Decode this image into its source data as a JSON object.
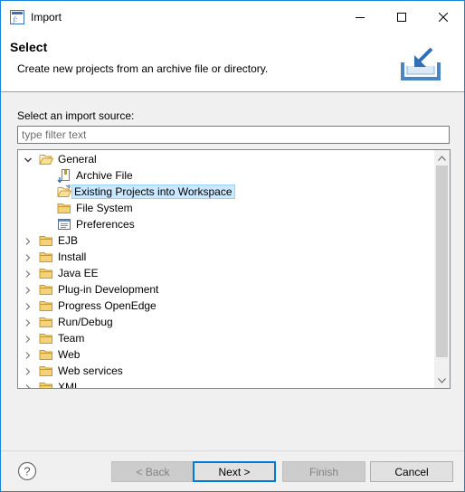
{
  "window": {
    "title": "Import"
  },
  "banner": {
    "title": "Select",
    "description": "Create new projects from an archive file or directory."
  },
  "source_label": "Select an import source:",
  "filter": {
    "value": "",
    "placeholder": "type filter text"
  },
  "tree": {
    "items": [
      {
        "label": "General",
        "expanded": true,
        "level": 0,
        "icon": "folder-open-icon"
      },
      {
        "label": "Archive File",
        "level": 1,
        "icon": "archive-file-icon"
      },
      {
        "label": "Existing Projects into Workspace",
        "level": 1,
        "icon": "existing-projects-icon",
        "selected": true
      },
      {
        "label": "File System",
        "level": 1,
        "icon": "folder-icon"
      },
      {
        "label": "Preferences",
        "level": 1,
        "icon": "preferences-icon"
      },
      {
        "label": "EJB",
        "level": 0,
        "icon": "folder-icon"
      },
      {
        "label": "Install",
        "level": 0,
        "icon": "folder-icon"
      },
      {
        "label": "Java EE",
        "level": 0,
        "icon": "folder-icon"
      },
      {
        "label": "Plug-in Development",
        "level": 0,
        "icon": "folder-icon"
      },
      {
        "label": "Progress OpenEdge",
        "level": 0,
        "icon": "folder-icon"
      },
      {
        "label": "Run/Debug",
        "level": 0,
        "icon": "folder-icon"
      },
      {
        "label": "Team",
        "level": 0,
        "icon": "folder-icon"
      },
      {
        "label": "Web",
        "level": 0,
        "icon": "folder-icon"
      },
      {
        "label": "Web services",
        "level": 0,
        "icon": "folder-icon"
      },
      {
        "label": "XML",
        "level": 0,
        "icon": "folder-icon"
      }
    ]
  },
  "buttons": {
    "back": "< Back",
    "next": "Next >",
    "finish": "Finish",
    "cancel": "Cancel"
  },
  "colors": {
    "accent": "#0078d7",
    "selection": "#cce8ff",
    "folder": "#e8c062"
  }
}
